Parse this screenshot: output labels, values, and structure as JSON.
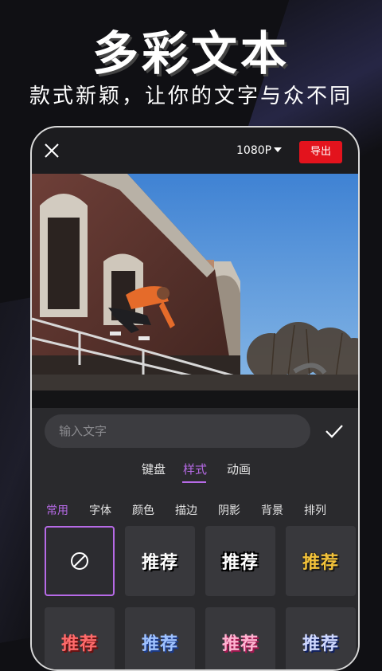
{
  "promo": {
    "headline": "多彩文本",
    "subline": "款式新颖，让你的文字与众不同"
  },
  "editor": {
    "resolution": "1080P",
    "export_label": "导出",
    "text_input": {
      "placeholder": "输入文字",
      "value": ""
    },
    "tabs": [
      {
        "label": "键盘"
      },
      {
        "label": "样式",
        "active": true
      },
      {
        "label": "动画"
      }
    ],
    "subtabs": [
      {
        "label": "常用",
        "active": true
      },
      {
        "label": "字体"
      },
      {
        "label": "颜色"
      },
      {
        "label": "描边"
      },
      {
        "label": "阴影"
      },
      {
        "label": "背景"
      },
      {
        "label": "排列"
      }
    ],
    "styles_row1": [
      {
        "icon": "no-style-icon",
        "selected": true
      },
      {
        "label": "推荐",
        "style": "white-shadow"
      },
      {
        "label": "推荐",
        "style": "white-outline"
      },
      {
        "label": "推荐",
        "style": "gold"
      }
    ],
    "styles_row2": [
      {
        "label": "推荐",
        "style": "red"
      },
      {
        "label": "推荐",
        "style": "blue"
      },
      {
        "label": "推荐",
        "style": "pink"
      },
      {
        "label": "推荐",
        "style": "navy"
      }
    ]
  },
  "colors": {
    "accent": "#b66ae6",
    "export_red": "#e3131d",
    "panel_bg": "#2a2a2d"
  }
}
